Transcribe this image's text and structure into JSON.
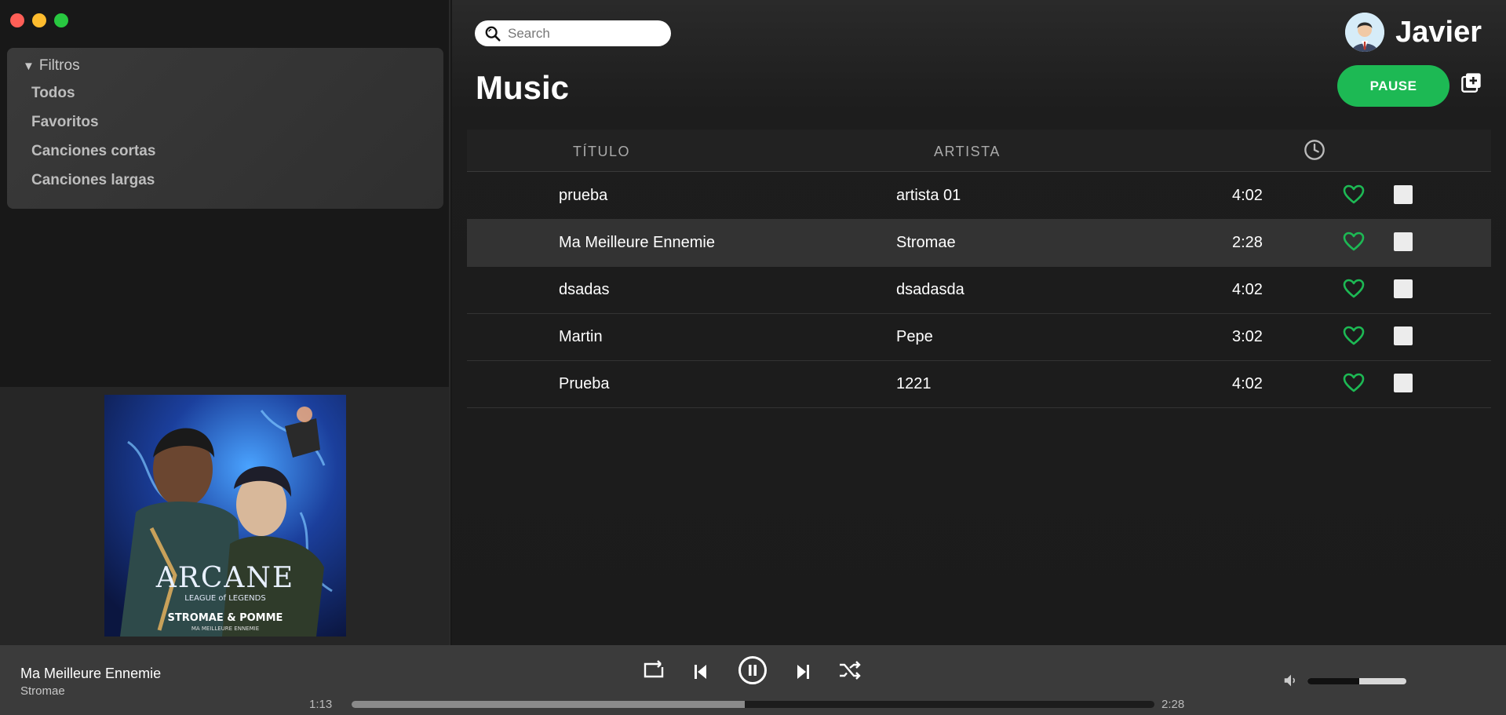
{
  "sidebar": {
    "filters_title": "Filtros",
    "filters": [
      "Todos",
      "Favoritos",
      "Canciones cortas",
      "Canciones largas"
    ]
  },
  "album_cover": {
    "title": "ARCANE",
    "subtitle": "LEAGUE of LEGENDS",
    "artists": "STROMAE & POMME",
    "song": "MA MEILLEURE ENNEMIE"
  },
  "header": {
    "search_placeholder": "Search",
    "user_name": "Javier",
    "page_title": "Music",
    "pause_label": "PAUSE"
  },
  "table": {
    "columns": {
      "title": "TÍTULO",
      "artist": "ARTISTA",
      "duration_icon": "clock-icon"
    },
    "rows": [
      {
        "title": "prueba",
        "artist": "artista 01",
        "duration": "4:02",
        "selected": false
      },
      {
        "title": "Ma Meilleure Ennemie",
        "artist": "Stromae",
        "duration": "2:28",
        "selected": true
      },
      {
        "title": "dsadas",
        "artist": "dsadasda",
        "duration": "4:02",
        "selected": false
      },
      {
        "title": "Martin",
        "artist": "Pepe",
        "duration": "3:02",
        "selected": false
      },
      {
        "title": "Prueba",
        "artist": "1221",
        "duration": "4:02",
        "selected": false
      }
    ]
  },
  "player": {
    "now_title": "Ma Meilleure Ennemie",
    "now_artist": "Stromae",
    "current_time": "1:13",
    "total_time": "2:28",
    "progress": 0.49,
    "volume": 0.52
  },
  "colors": {
    "accent": "#1db954",
    "heart": "#1db954"
  }
}
